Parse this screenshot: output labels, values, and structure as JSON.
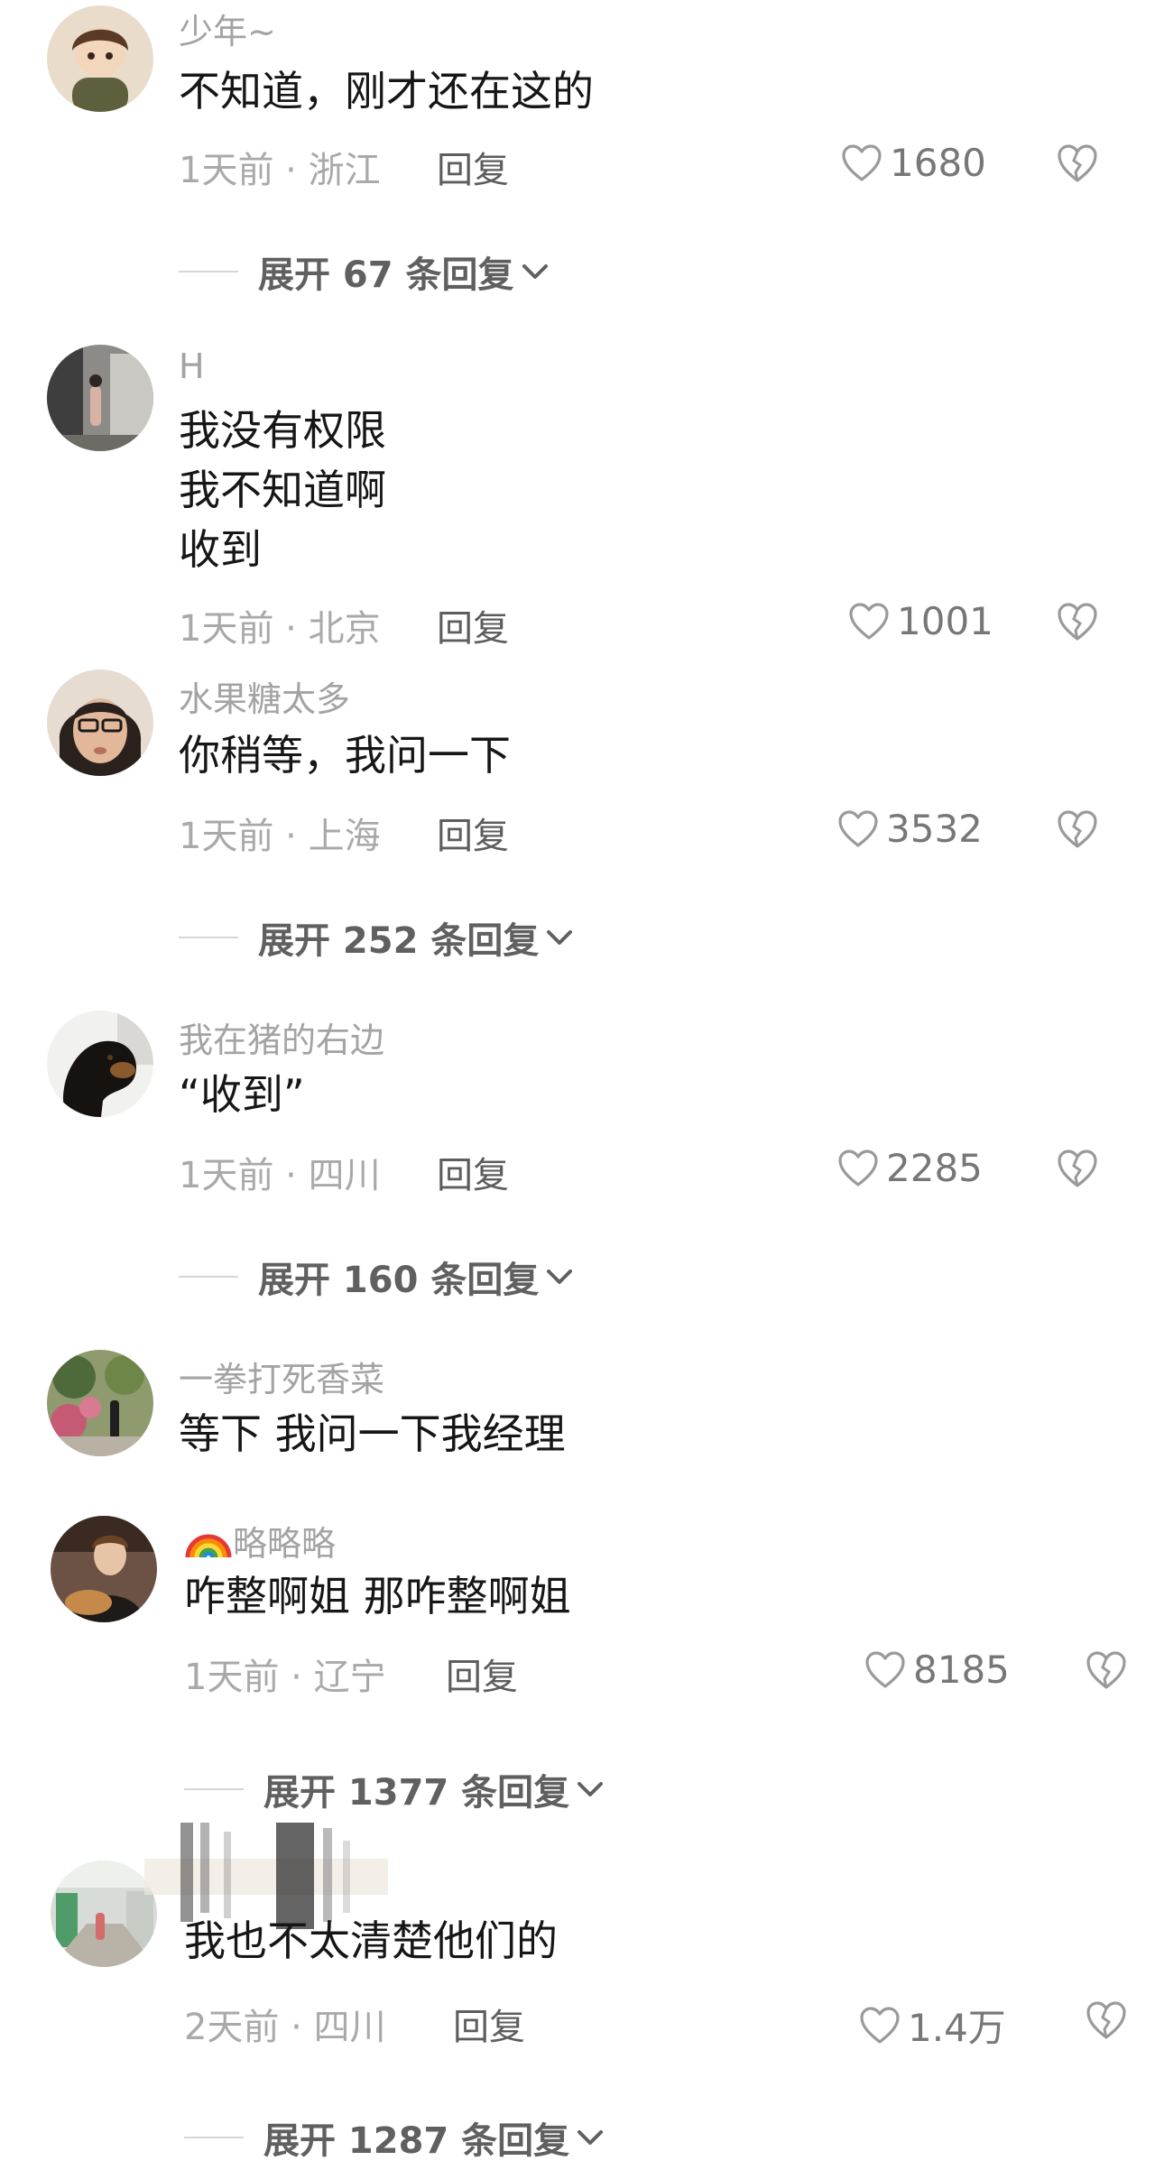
{
  "comments": [
    {
      "username": "少年~",
      "lines": [
        "不知道，刚才还在这的"
      ],
      "meta": "1天前 · 浙江",
      "reply_label": "回复",
      "likes": "1680",
      "expand_label": "展开 67 条回复"
    },
    {
      "username": "H",
      "lines": [
        "我没有权限",
        "我不知道啊",
        "收到"
      ],
      "meta": "1天前 · 北京",
      "reply_label": "回复",
      "likes": "1001"
    },
    {
      "username": "水果糖太多",
      "lines": [
        "你稍等，我问一下"
      ],
      "meta": "1天前 · 上海",
      "reply_label": "回复",
      "likes": "3532",
      "expand_label": "展开 252 条回复"
    },
    {
      "username": "我在猪的右边",
      "lines": [
        "“收到”"
      ],
      "meta": "1天前 · 四川",
      "reply_label": "回复",
      "likes": "2285",
      "expand_label": "展开 160 条回复"
    },
    {
      "username": "一拳打死香菜",
      "lines": [
        "等下 我问一下我经理"
      ]
    },
    {
      "username": "🌈略略略",
      "lines": [
        "咋整啊姐 那咋整啊姐"
      ],
      "meta": "1天前 · 辽宁",
      "reply_label": "回复",
      "likes": "8185",
      "expand_label": "展开 1377 条回复"
    },
    {
      "username": "",
      "lines": [
        "我也不太清楚他们的"
      ],
      "meta": "2天前 · 四川",
      "reply_label": "回复",
      "likes": "1.4万",
      "expand_label": "展开 1287 条回复"
    }
  ],
  "colors": {
    "text": "#161616",
    "username": "#a3a3a3",
    "meta": "#a9a9a9",
    "reply": "#5d5d5d",
    "expand": "#606060"
  },
  "icons": [
    "heart-outline-icon",
    "broken-heart-icon",
    "chevron-down-icon",
    "rainbow-icon"
  ]
}
